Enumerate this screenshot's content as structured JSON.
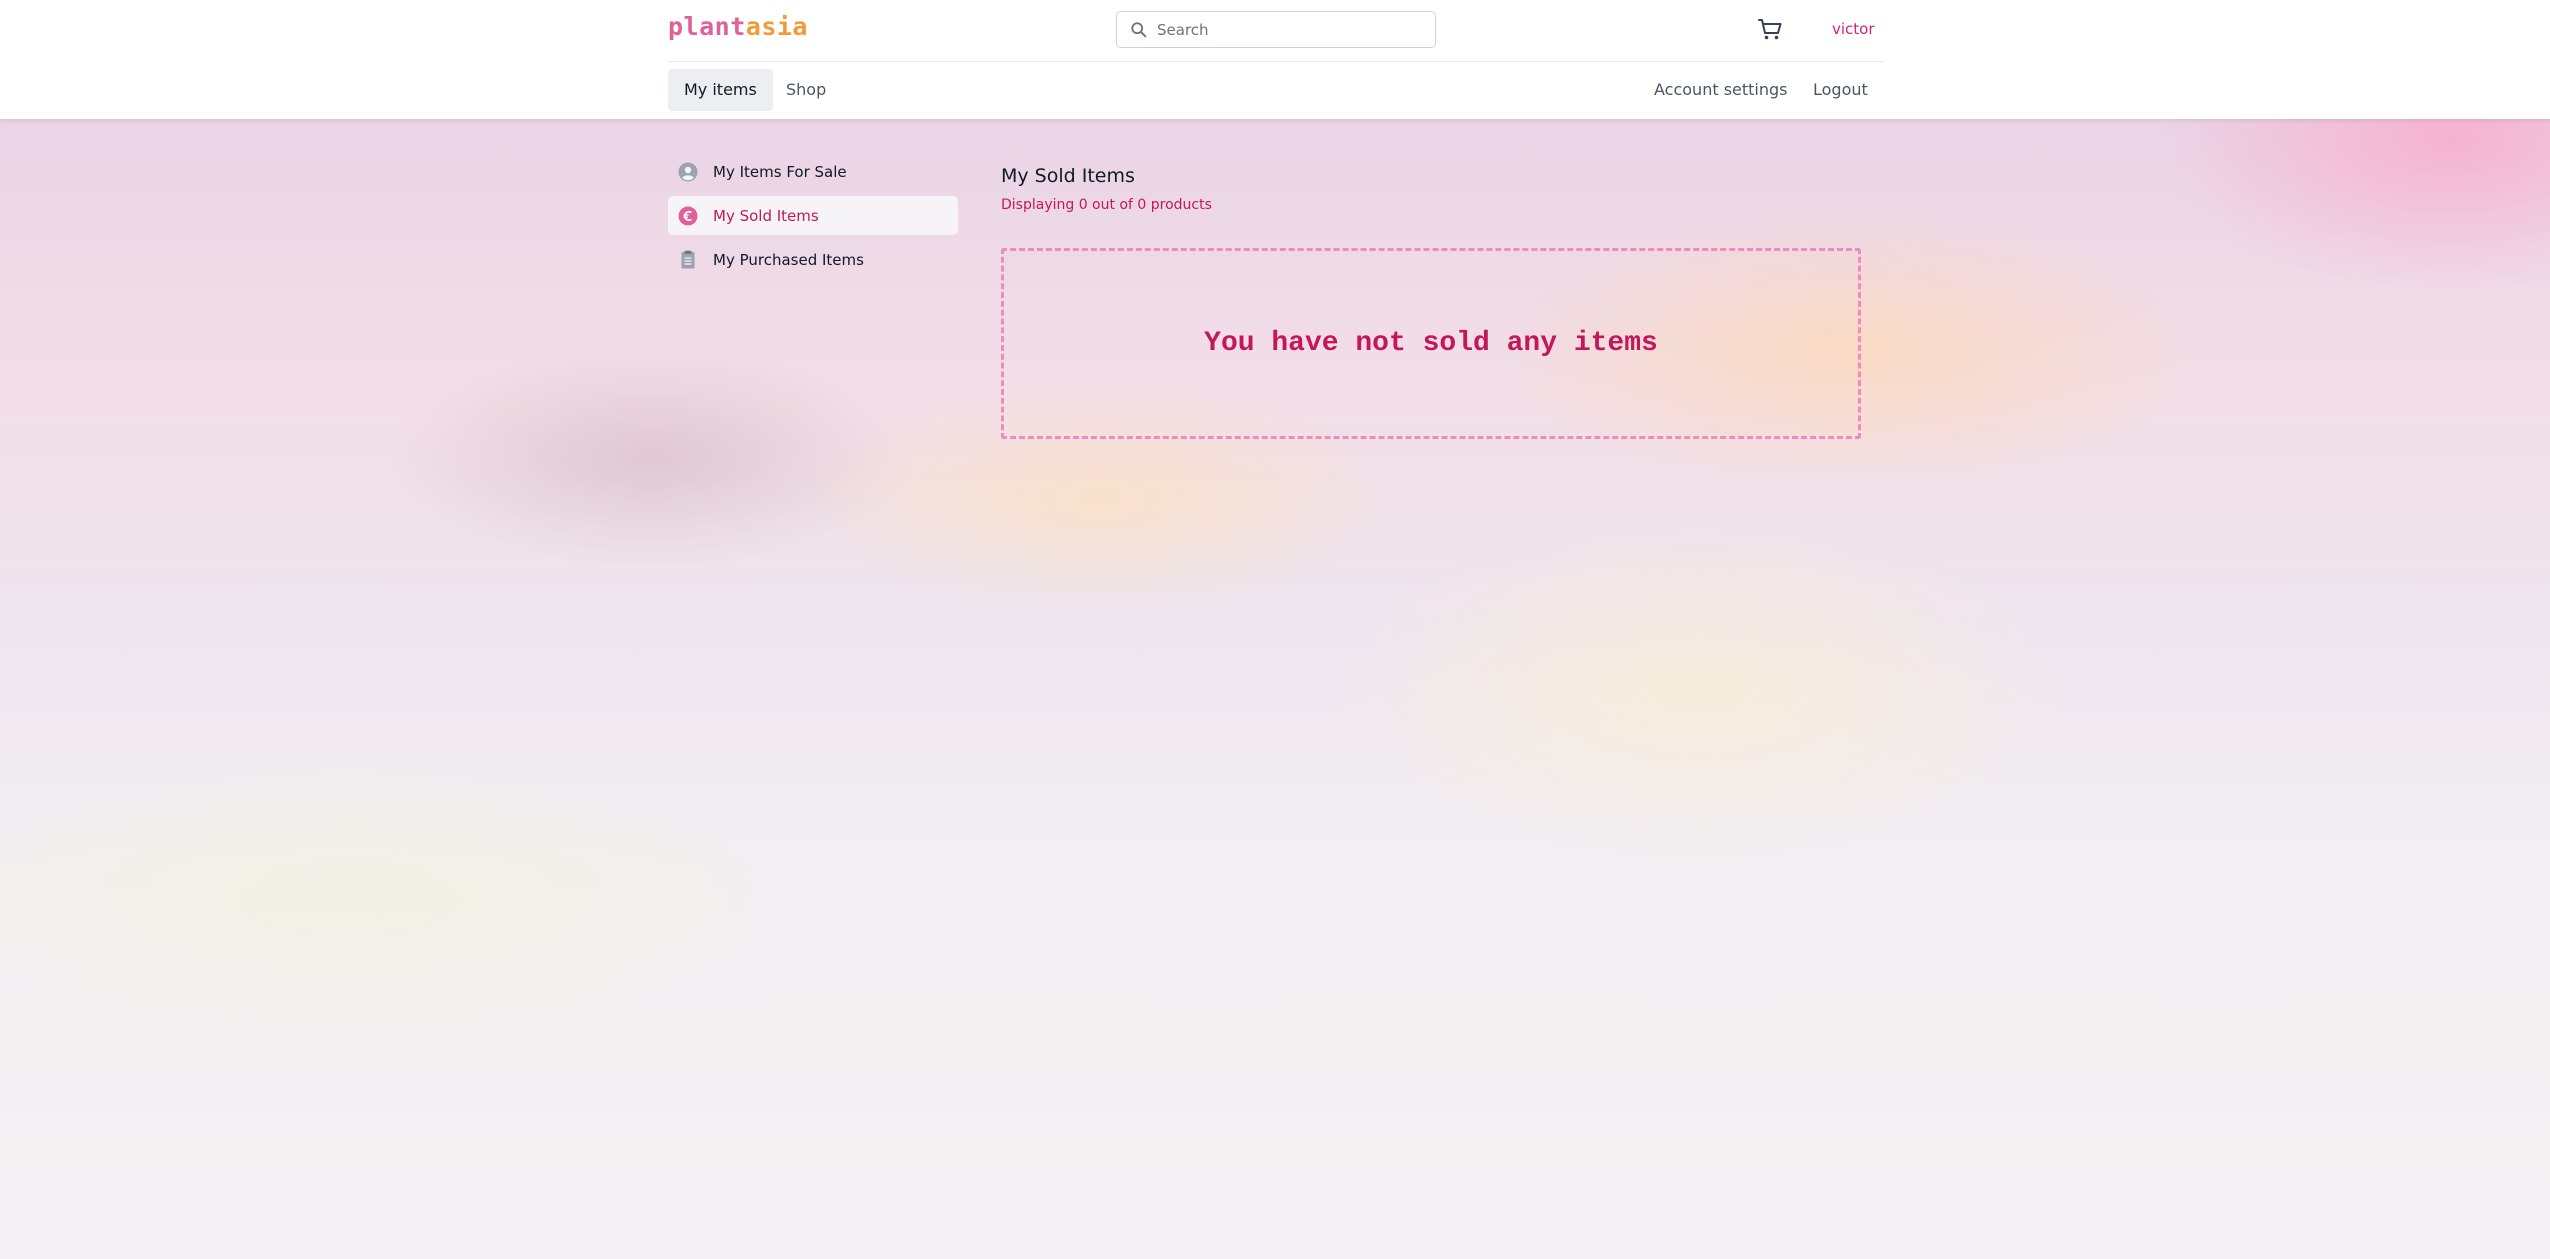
{
  "brand": {
    "part1": "plant",
    "part2": "asia"
  },
  "search": {
    "placeholder": "Search"
  },
  "header": {
    "cart_icon": "shopping-cart-icon",
    "username": "victor"
  },
  "nav": {
    "tabs": [
      {
        "label": "My items",
        "active": true
      },
      {
        "label": "Shop",
        "active": false
      }
    ],
    "right": [
      {
        "label": "Account settings"
      },
      {
        "label": "Logout"
      }
    ]
  },
  "sidebar": {
    "items": [
      {
        "label": "My Items For Sale",
        "icon": "user-circle-icon",
        "active": false
      },
      {
        "label": "My Sold Items",
        "icon": "euro-coin-icon",
        "active": true
      },
      {
        "label": "My Purchased Items",
        "icon": "receipt-icon",
        "active": false
      }
    ]
  },
  "main": {
    "title": "My Sold Items",
    "count_text": "Displaying 0 out of 0 products",
    "empty_message": "You have not sold any items"
  },
  "colors": {
    "accent": "#c2185b",
    "logo_pink": "#e0609a",
    "logo_orange": "#f29b38",
    "dashed_border": "#f08bbf"
  }
}
